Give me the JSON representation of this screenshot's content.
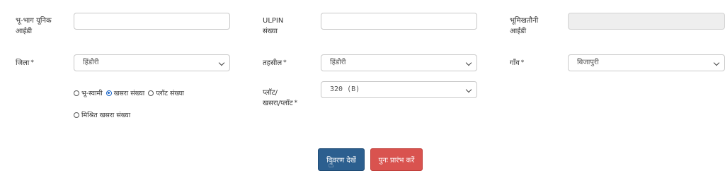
{
  "form": {
    "plot_unique_id": {
      "label_line1": "भू-भाग यूनिक",
      "label_line2": "आईडी",
      "value": ""
    },
    "ulpin": {
      "label_line1": "ULPIN",
      "label_line2": "संख्या",
      "value": ""
    },
    "land_record_id": {
      "label_line1": "भूमिखतौनी",
      "label_line2": "आईडी",
      "value": ""
    },
    "district": {
      "label": "जिला",
      "required_mark": "*",
      "selected": "हिंडौरी"
    },
    "tehsil": {
      "label": "तहसील",
      "required_mark": "*",
      "selected": "हिंडौरी"
    },
    "village": {
      "label": "गाँव",
      "required_mark": "*",
      "selected": "बिजापुरी"
    },
    "search_by": {
      "options": [
        {
          "label": "भू-स्वामी",
          "checked": false
        },
        {
          "label": "खसरा संख्या",
          "checked": true
        },
        {
          "label": "प्लॉट संख्या",
          "checked": false
        }
      ],
      "option_row2": {
        "label": "मिश्रित खसरा संख्या",
        "checked": false
      }
    },
    "plot_khasra": {
      "label_line1": "प्लॉट/",
      "label_line2": "खसरा/प्लॉट",
      "required_mark": "*",
      "selected": "320 (B)"
    }
  },
  "actions": {
    "view_details_label": "विवरण देखें",
    "reset_label": "पुनः प्रारंभ करें"
  }
}
